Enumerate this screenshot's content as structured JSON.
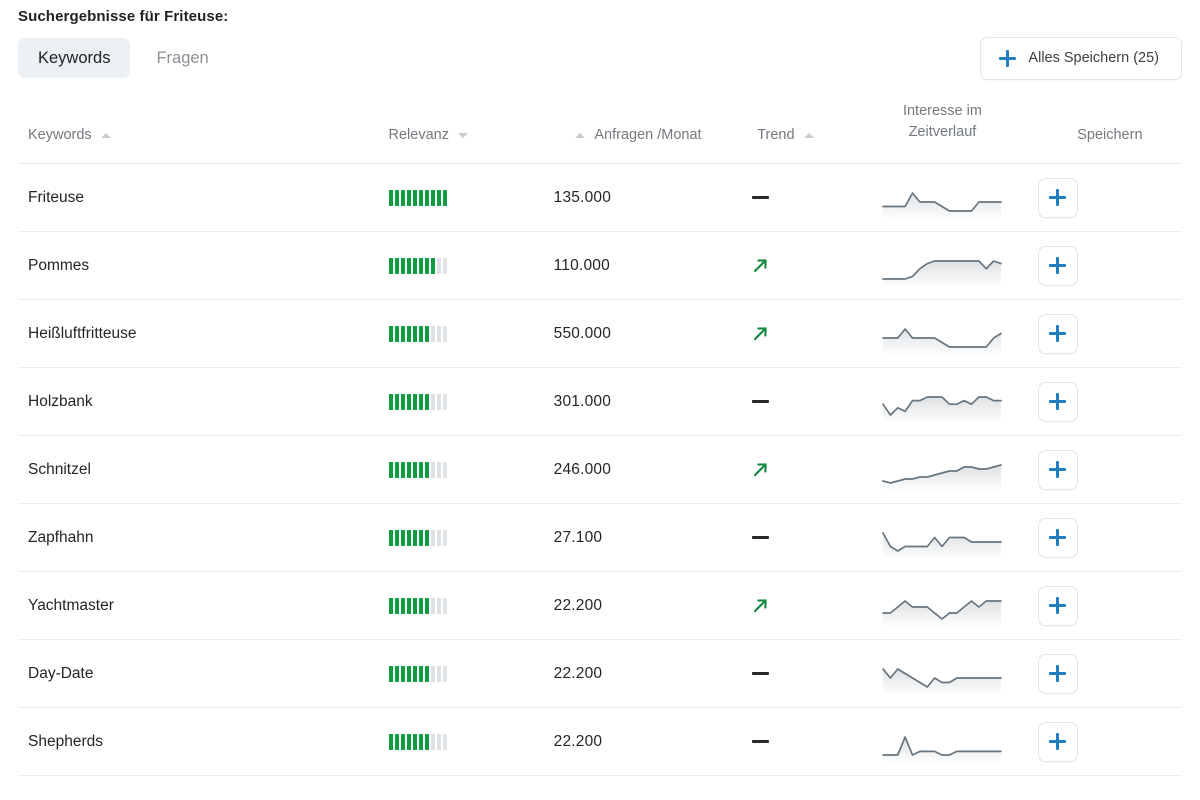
{
  "header": {
    "title": "Suchergebnisse für Friteuse:"
  },
  "tabs": [
    {
      "label": "Keywords",
      "active": true
    },
    {
      "label": "Fragen",
      "active": false
    }
  ],
  "save_all": {
    "label": "Alles Speichern (25)",
    "icon": "plus-icon",
    "accent": "#1f7fc0"
  },
  "table": {
    "columns": [
      {
        "key": "keyword",
        "label": "Keywords",
        "sort": "asc",
        "align": "left"
      },
      {
        "key": "relevanz",
        "label": "Relevanz",
        "sort": "desc",
        "align": "left"
      },
      {
        "key": "volume",
        "label": "Anfragen /Monat",
        "sort": "asc",
        "align": "right"
      },
      {
        "key": "trend",
        "label": "Trend",
        "sort": "asc",
        "align": "left"
      },
      {
        "key": "spark",
        "label_line1": "Interesse im",
        "label_line2": "Zeitverlauf",
        "sort": "none",
        "align": "center"
      },
      {
        "key": "save",
        "label": "Speichern",
        "sort": "none",
        "align": "center"
      }
    ],
    "relevance_max": 10,
    "colors": {
      "bar_on": "#0f9b3f",
      "bar_off": "#dfe2e5",
      "trend_up": "#12883d",
      "trend_flat": "#26292c",
      "spark_line": "#68757f"
    },
    "rows": [
      {
        "keyword": "Friteuse",
        "relevance": 10,
        "volume": "135.000",
        "trend": "flat",
        "save_label": "+",
        "sparkline": [
          5,
          5,
          5,
          5,
          8,
          6,
          6,
          6,
          5,
          4,
          4,
          4,
          4,
          6,
          6,
          6,
          6
        ]
      },
      {
        "keyword": "Pommes",
        "relevance": 8,
        "volume": "110.000",
        "trend": "up",
        "save_label": "+",
        "sparkline": [
          2,
          2,
          2,
          2,
          3,
          6,
          8,
          9,
          9,
          9,
          9,
          9,
          9,
          9,
          6,
          9,
          8
        ]
      },
      {
        "keyword": "Heißluftfritteuse",
        "relevance": 7,
        "volume": "550.000",
        "trend": "up",
        "save_label": "+",
        "sparkline": [
          7,
          7,
          7,
          9,
          7,
          7,
          7,
          7,
          6,
          5,
          5,
          5,
          5,
          5,
          5,
          7,
          8
        ]
      },
      {
        "keyword": "Holzbank",
        "relevance": 7,
        "volume": "301.000",
        "trend": "flat",
        "save_label": "+",
        "sparkline": [
          7,
          4,
          6,
          5,
          8,
          8,
          9,
          9,
          9,
          7,
          7,
          8,
          7,
          9,
          9,
          8,
          8
        ]
      },
      {
        "keyword": "Schnitzel",
        "relevance": 7,
        "volume": "246.000",
        "trend": "up",
        "save_label": "+",
        "sparkline": [
          2,
          1,
          2,
          3,
          3,
          4,
          4,
          5,
          6,
          7,
          7,
          9,
          9,
          8,
          8,
          9,
          10
        ]
      },
      {
        "keyword": "Zapfhahn",
        "relevance": 7,
        "volume": "27.100",
        "trend": "flat",
        "save_label": "+",
        "sparkline": [
          8,
          5,
          4,
          5,
          5,
          5,
          5,
          7,
          5,
          7,
          7,
          7,
          6,
          6,
          6,
          6,
          6
        ]
      },
      {
        "keyword": "Yachtmaster",
        "relevance": 7,
        "volume": "22.200",
        "trend": "up",
        "save_label": "+",
        "sparkline": [
          6,
          6,
          7,
          8,
          7,
          7,
          7,
          6,
          5,
          6,
          6,
          7,
          8,
          7,
          8,
          8,
          8
        ]
      },
      {
        "keyword": "Day-Date",
        "relevance": 7,
        "volume": "22.200",
        "trend": "flat",
        "save_label": "+",
        "sparkline": [
          8,
          6,
          8,
          7,
          6,
          5,
          4,
          6,
          5,
          5,
          6,
          6,
          6,
          6,
          6,
          6,
          6
        ]
      },
      {
        "keyword": "Shepherds",
        "relevance": 7,
        "volume": "22.200",
        "trend": "flat",
        "save_label": "+",
        "sparkline": [
          4,
          4,
          4,
          9,
          4,
          5,
          5,
          5,
          4,
          4,
          5,
          5,
          5,
          5,
          5,
          5,
          5
        ]
      }
    ]
  }
}
